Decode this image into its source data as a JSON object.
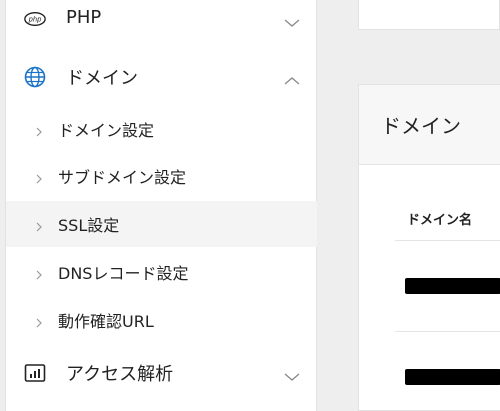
{
  "sidebar": {
    "php": {
      "label": "PHP",
      "icon": "php-icon"
    },
    "domain": {
      "label": "ドメイン",
      "icon": "globe-icon"
    },
    "sub_items": [
      {
        "label": "ドメイン設定"
      },
      {
        "label": "サブドメイン設定"
      },
      {
        "label": "SSL設定"
      },
      {
        "label": "DNSレコード設定"
      },
      {
        "label": "動作確認URL"
      }
    ],
    "access": {
      "label": "アクセス解析",
      "icon": "bar-chart-icon"
    }
  },
  "main": {
    "panel_title": "ドメイン",
    "table": {
      "columns": [
        "ドメイン名"
      ],
      "rows": 2
    }
  },
  "colors": {
    "accent": "#1a73c8",
    "redacted": "#000000"
  }
}
